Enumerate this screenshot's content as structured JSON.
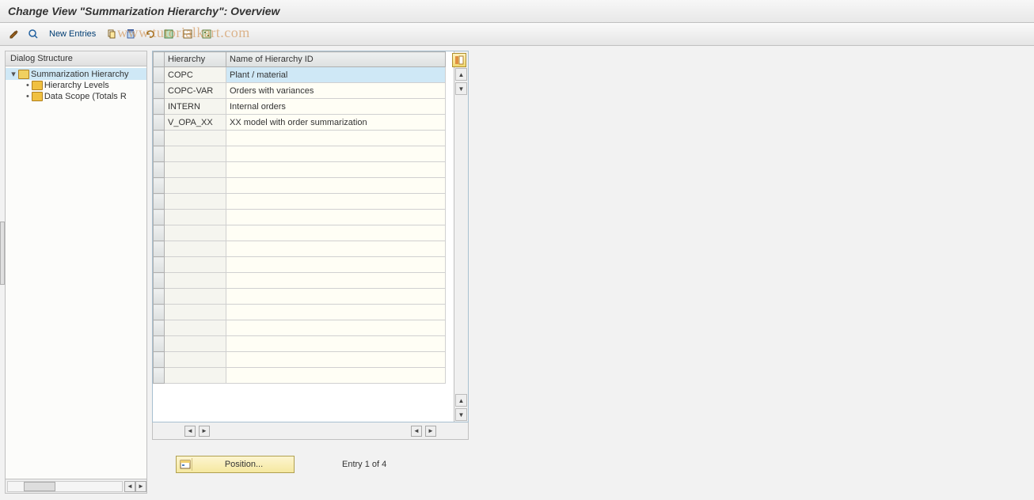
{
  "title": "Change View \"Summarization Hierarchy\": Overview",
  "watermark": "www.tutorialkart.com",
  "toolbar": {
    "new_entries": "New Entries"
  },
  "left_panel": {
    "header": "Dialog Structure",
    "items": [
      {
        "label": "Summarization Hierarchy",
        "expanded": true,
        "selected": true,
        "open": true
      },
      {
        "label": "Hierarchy Levels",
        "indent": 1
      },
      {
        "label": "Data Scope (Totals R",
        "indent": 1
      }
    ]
  },
  "grid": {
    "columns": [
      "Hierarchy",
      "Name of Hierarchy ID"
    ],
    "rows": [
      {
        "hierarchy": "COPC",
        "name": "Plant / material",
        "selected": true
      },
      {
        "hierarchy": "COPC-VAR",
        "name": "Orders with variances"
      },
      {
        "hierarchy": "INTERN",
        "name": "Internal orders"
      },
      {
        "hierarchy": "V_OPA_XX",
        "name": "XX model with order summarization"
      }
    ],
    "blank_rows": 16
  },
  "footer": {
    "position_label": "Position...",
    "entry_text": "Entry 1 of 4"
  }
}
